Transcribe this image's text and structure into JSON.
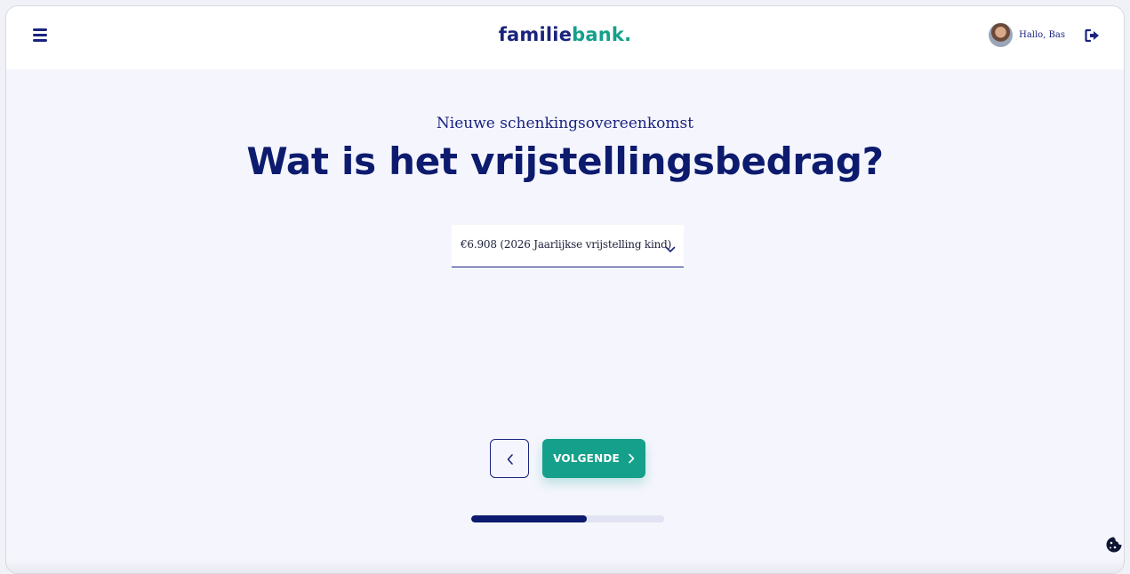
{
  "header": {
    "logo": {
      "part1": "familie",
      "part2": "bank",
      "dot": "."
    },
    "menu_icon": "hamburger-menu-icon",
    "user": {
      "greeting": "Hallo, Bas",
      "avatar": "user-avatar"
    },
    "logout_icon": "logout-icon"
  },
  "main": {
    "subtitle": "Nieuwe schenkingsovereenkomst",
    "title": "Wat is het vrijstellingsbedrag?",
    "select": {
      "value": "€6.908 (2026 Jaarlijkse vrijstelling kind)",
      "icon": "chevron-down-icon"
    }
  },
  "nav": {
    "back_icon": "chevron-left-icon",
    "next_label": "VOLGENDE",
    "next_icon": "chevron-right-icon"
  },
  "progress": {
    "fraction": 0.6
  },
  "cookie_icon": "cookie-icon",
  "colors": {
    "primary": "#1a237e",
    "title": "#0d1b6e",
    "accent": "#14a08a",
    "background": "#f5f6fd"
  }
}
